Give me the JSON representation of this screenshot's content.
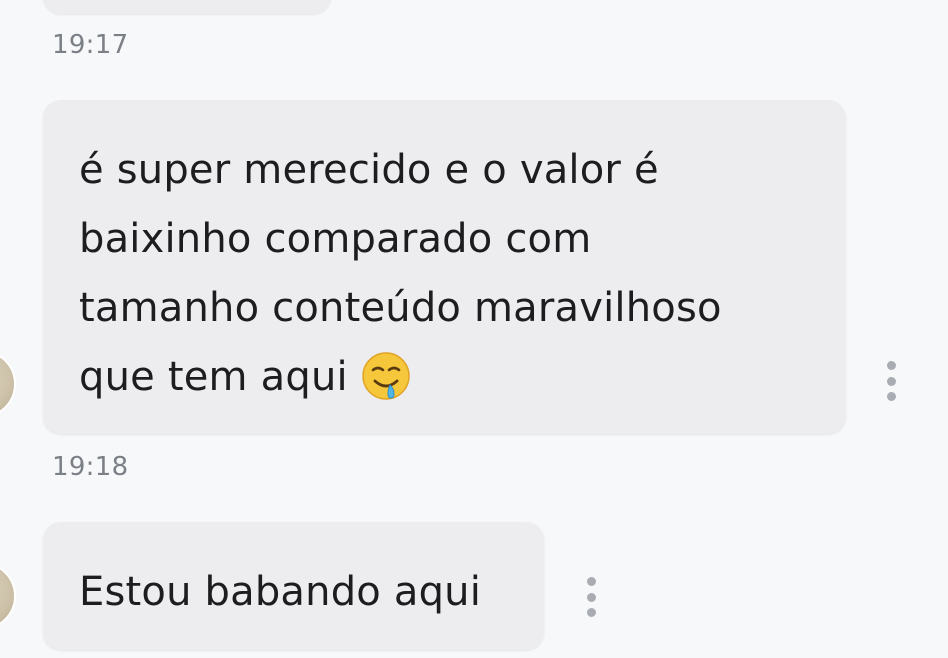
{
  "messages": [
    {
      "time": "19:17",
      "text": "é super merecido e o valor é\nbaixinho comparado com\ntamanho conteúdo maravilhoso\nque tem aqui ",
      "emoji": "drooling-face-icon"
    },
    {
      "time": "19:18",
      "text": "Estou babando aqui"
    }
  ],
  "colors": {
    "background": "#f7f8fa",
    "bubble": "#ededf0",
    "text": "#1d1d1f",
    "timestamp": "#7b7f86",
    "kebab": "#a9adb3"
  }
}
